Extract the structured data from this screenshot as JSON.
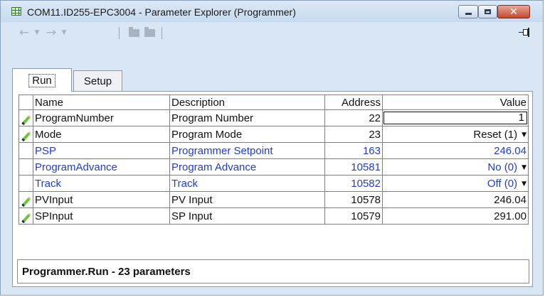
{
  "window": {
    "title": "COM11.ID255-EPC3004 - Parameter Explorer (Programmer)",
    "close_glyph": "✕"
  },
  "toolbar": {
    "back_icon": "←",
    "dropdown_icon": "▼",
    "forward_icon": "→"
  },
  "tabs": [
    {
      "label": "Run",
      "active": true
    },
    {
      "label": "Setup",
      "active": false
    }
  ],
  "table": {
    "columns": [
      "Name",
      "Description",
      "Address",
      "Value"
    ],
    "rows": [
      {
        "name": "ProgramNumber",
        "description": "Program Number",
        "address": "22",
        "value": "1",
        "editable": true,
        "color": "black"
      },
      {
        "name": "Mode",
        "description": "Program Mode",
        "address": "23",
        "value": "Reset (1)",
        "editable": true,
        "dropdown": true,
        "color": "black"
      },
      {
        "name": "PSP",
        "description": "Programmer Setpoint",
        "address": "163",
        "value": "246.04",
        "editable": false,
        "color": "blue"
      },
      {
        "name": "ProgramAdvance",
        "description": "Program Advance",
        "address": "10581",
        "value": "No (0)",
        "editable": false,
        "dropdown": true,
        "color": "blue"
      },
      {
        "name": "Track",
        "description": "Track",
        "address": "10582",
        "value": "Off (0)",
        "editable": false,
        "dropdown": true,
        "color": "blue"
      },
      {
        "name": "PVInput",
        "description": "PV Input",
        "address": "10578",
        "value": "246.04",
        "editable": true,
        "color": "black"
      },
      {
        "name": "SPInput",
        "description": "SP Input",
        "address": "10579",
        "value": "291.00",
        "editable": true,
        "color": "black"
      }
    ]
  },
  "status": {
    "text": "Programmer.Run  -  23 parameters"
  },
  "colors": {
    "blue_text": "#1f3cd6",
    "title_bg": "#c7daef",
    "close_button": "#c24a31"
  }
}
